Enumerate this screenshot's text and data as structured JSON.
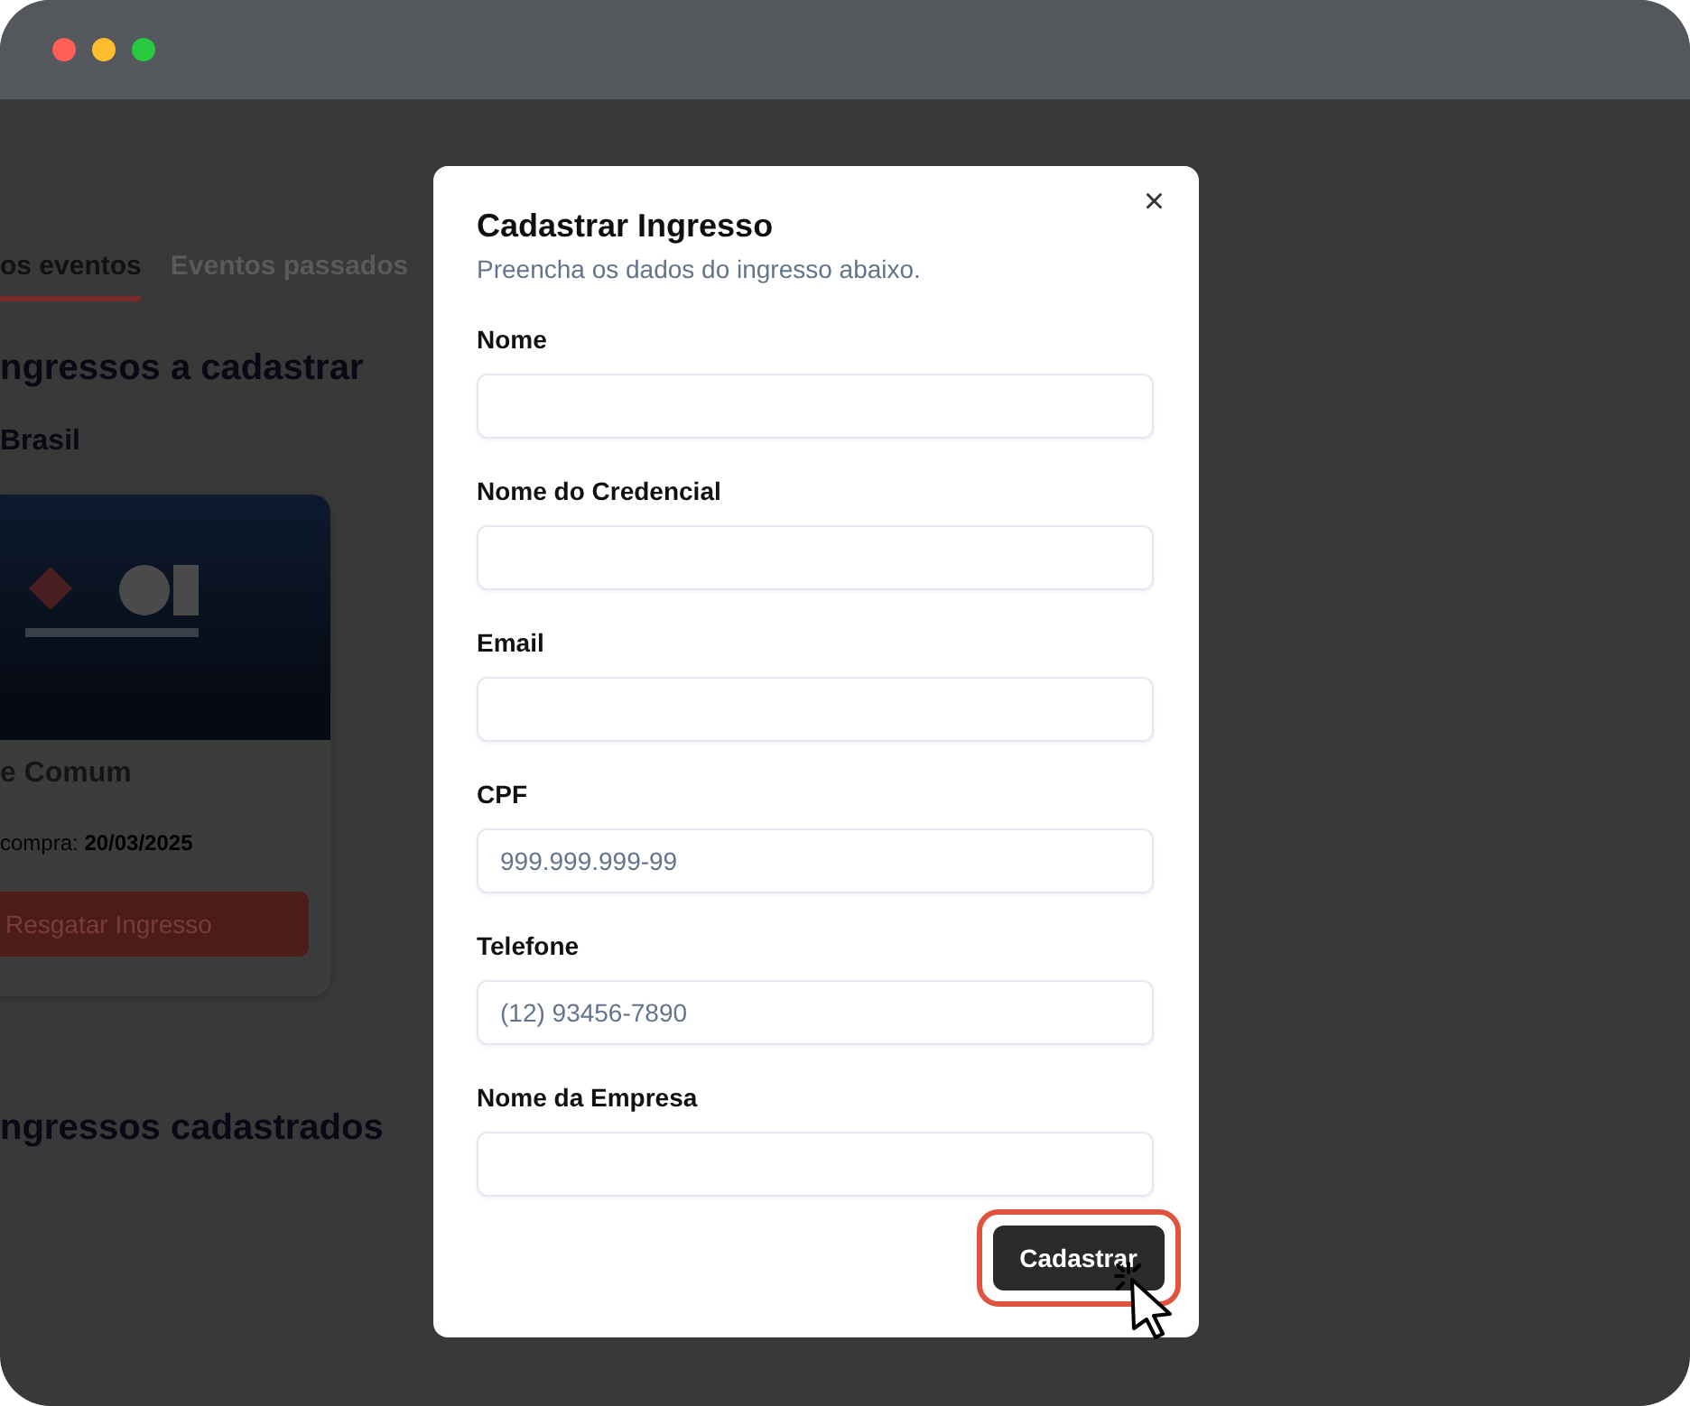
{
  "background": {
    "tabs": [
      {
        "label": "os eventos",
        "selected": true
      },
      {
        "label": "Eventos passados",
        "selected": false
      }
    ],
    "section_title": "ngressos a cadastrar",
    "event_name": "Brasil",
    "ticket_card": {
      "title": "e Comum",
      "purchase_date": "compra: **20/03/2025**",
      "button": "Resgatar Ingresso"
    },
    "registered_title": "ngressos cadastrados"
  },
  "dialog": {
    "title": "Cadastrar Ingresso",
    "subtitle": "Preencha os dados do ingresso abaixo.",
    "close": "×",
    "fields": [
      {
        "label": "Nome"
      },
      {
        "label": "Nome do Credencial"
      },
      {
        "label": "Email"
      },
      {
        "label": "CPF",
        "placeholder": "999.999.999-99"
      },
      {
        "label": "Telefone",
        "placeholder": "(12) 93456-7890"
      },
      {
        "label": "Nome da Empresa"
      }
    ],
    "submit_button": {
      "label": "Cadastrar",
      "highlighted": true
    }
  }
}
